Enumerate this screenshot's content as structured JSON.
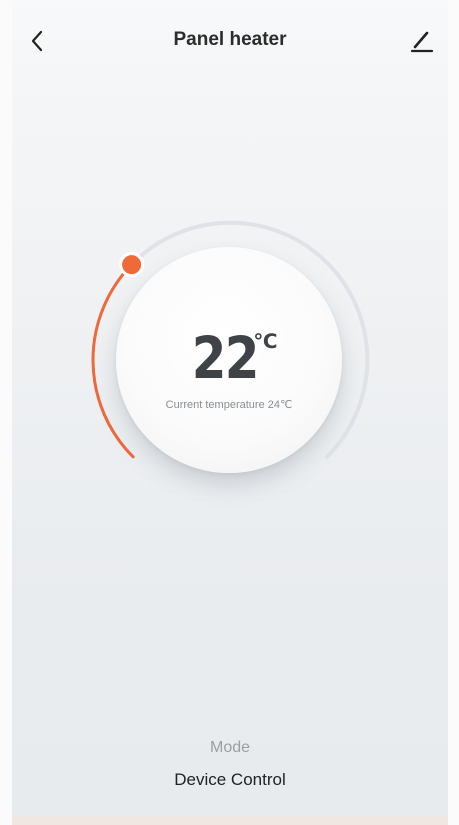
{
  "header": {
    "title": "Panel heater",
    "back_icon": "chevron-left-icon",
    "edit_icon": "pencil-icon"
  },
  "thermostat": {
    "setpoint": "22",
    "unit": "℃",
    "current_temperature_text": "Current temperature 24℃",
    "setpoint_fraction": 0.33,
    "colors": {
      "active_arc": "#ec6a3d",
      "inactive_arc": "#dfe2e6",
      "handle": "#ef6a3a",
      "handle_border": "#ffffff",
      "text": "#3f4347"
    }
  },
  "footer": {
    "mode_label": "Mode",
    "device_control_label": "Device Control"
  },
  "colors": {
    "background": "#eef0f2",
    "accent": "#ec6a3d"
  }
}
